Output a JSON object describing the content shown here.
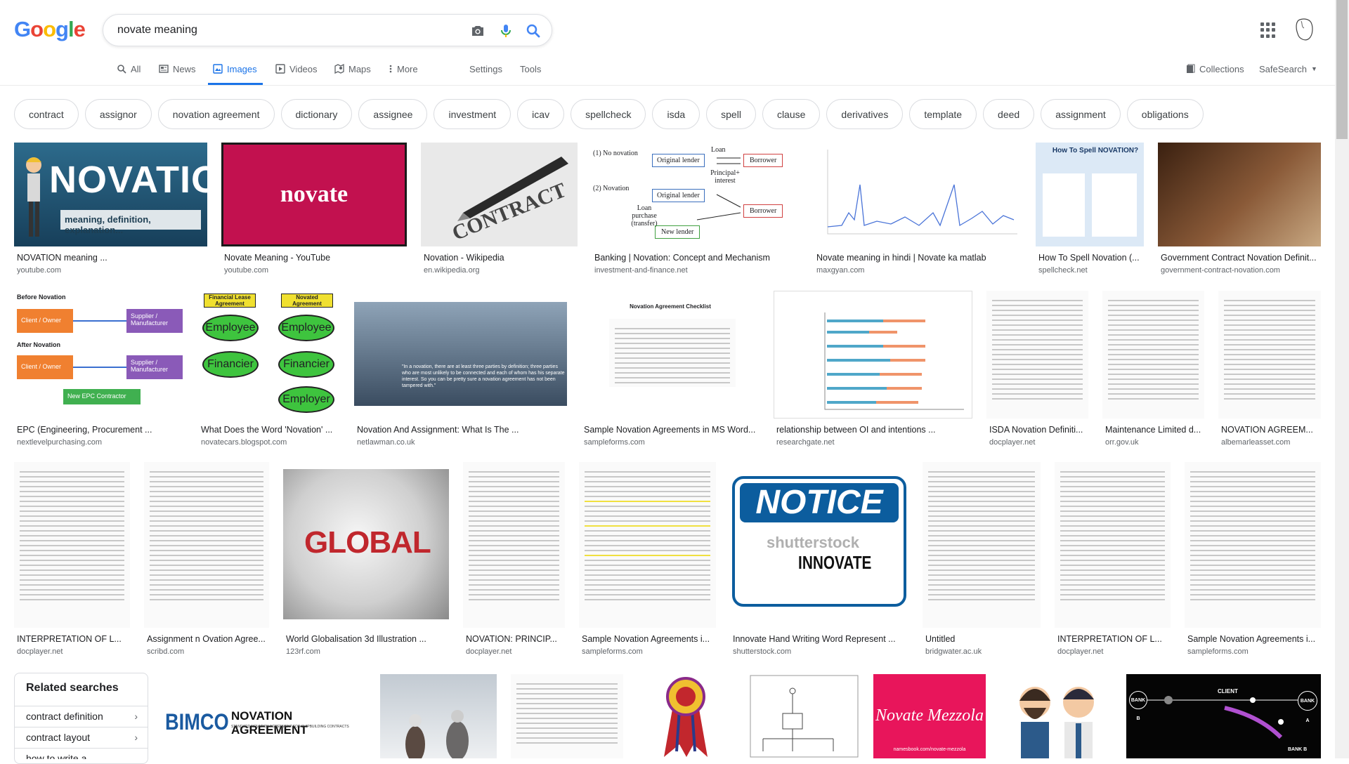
{
  "logo": [
    "G",
    "o",
    "o",
    "g",
    "l",
    "e"
  ],
  "logo_colors": [
    "#4285f4",
    "#ea4335",
    "#fbbc05",
    "#4285f4",
    "#34a853",
    "#ea4335"
  ],
  "search": {
    "query": "novate meaning"
  },
  "tabs": {
    "all": "All",
    "news": "News",
    "images": "Images",
    "videos": "Videos",
    "maps": "Maps",
    "more": "More",
    "settings": "Settings",
    "tools": "Tools",
    "collections": "Collections",
    "safesearch": "SafeSearch"
  },
  "chips": [
    "contract",
    "assignor",
    "novation agreement",
    "dictionary",
    "assignee",
    "investment",
    "icav",
    "spellcheck",
    "isda",
    "spell",
    "clause",
    "derivatives",
    "template",
    "deed",
    "assignment",
    "obligations"
  ],
  "results": [
    {
      "title": "NOVATION meaning ...",
      "source": "youtube.com"
    },
    {
      "title": "Novate Meaning - YouTube",
      "source": "youtube.com"
    },
    {
      "title": "Novation - Wikipedia",
      "source": "en.wikipedia.org"
    },
    {
      "title": "Banking | Novation: Concept and Mechanism",
      "source": "investment-and-finance.net"
    },
    {
      "title": "Novate meaning in hindi | Novate ka matlab",
      "source": "maxgyan.com"
    },
    {
      "title": "How To Spell Novation (...",
      "source": "spellcheck.net"
    },
    {
      "title": "Government Contract Novation Definit...",
      "source": "government-contract-novation.com"
    },
    {
      "title": "EPC (Engineering, Procurement ...",
      "source": "nextlevelpurchasing.com"
    },
    {
      "title": "What Does the Word 'Novation' ...",
      "source": "novatecars.blogspot.com"
    },
    {
      "title": "Novation And Assignment: What Is The ...",
      "source": "netlawman.co.uk"
    },
    {
      "title": "Sample Novation Agreements in MS Word...",
      "source": "sampleforms.com"
    },
    {
      "title": "relationship between OI and intentions ...",
      "source": "researchgate.net"
    },
    {
      "title": "ISDA Novation Definiti...",
      "source": "docplayer.net"
    },
    {
      "title": "Maintenance Limited d...",
      "source": "orr.gov.uk"
    },
    {
      "title": "NOVATION AGREEM...",
      "source": "albemarleasset.com"
    },
    {
      "title": "INTERPRETATION OF L...",
      "source": "docplayer.net"
    },
    {
      "title": "Assignment n Ovation Agree...",
      "source": "scribd.com"
    },
    {
      "title": "World Globalisation 3d Illustration ...",
      "source": "123rf.com"
    },
    {
      "title": "NOVATION: PRINCIP...",
      "source": "docplayer.net"
    },
    {
      "title": "Sample Novation Agreements i...",
      "source": "sampleforms.com"
    },
    {
      "title": "Innovate Hand Writing Word Represent ...",
      "source": "shutterstock.com"
    },
    {
      "title": "Untitled",
      "source": "bridgwater.ac.uk"
    },
    {
      "title": "INTERPRETATION OF L...",
      "source": "docplayer.net"
    },
    {
      "title": "Sample Novation Agreements i...",
      "source": "sampleforms.com"
    }
  ],
  "thumb_text": {
    "novation_big": "NOVATION",
    "novation_sub": "meaning, definition, explanation...",
    "novate": "novate",
    "contract": "CONTRACT",
    "no_novation": "(1) No novation",
    "novation": "(2) Novation",
    "original_lender": "Original lender",
    "borrower": "Borrower",
    "loan": "Loan",
    "principal_interest": "Principal+ interest",
    "new_lender": "New lender",
    "loan_purchase": "Loan purchase (transfer)",
    "how_to_spell": "How To Spell NOVATION?",
    "before_novation": "Before Novation",
    "after_novation": "After Novation",
    "client_owner": "Client / Owner",
    "supplier": "Supplier / Manufacturer",
    "new_epc": "New EPC Contractor",
    "financial_lease": "Financial Lease Agreement",
    "novated_agreement": "Novated Agreement",
    "employee": "Employee",
    "financier": "Financier",
    "employer": "Employer",
    "quote": "\"In a novation, there are at least three parties by definition; three parties who are most unlikely to be connected and each of whom has his separate interest. So you can be pretty sure a novation agreement has not been tampered with.\"",
    "novation_checklist": "Novation Agreement Checklist",
    "global": "GLOBAL",
    "notice": "NOTICE",
    "shutterstock": "shutterstock",
    "innovate": "INNOVATE",
    "bimco": "BIMCO",
    "novation_agreement": "NOVATION AGREEMENT",
    "bimco_sub": "STANDARD NOVATION AGREEMENT FOR SHIPBUILDING CONTRACTS",
    "novate_mezzola": "Novate Mezzola",
    "namesbook": "namesbook.com/novate-mezzola",
    "bank_b": "BANK B",
    "bank_a": "BANK A",
    "client": "CLIENT"
  },
  "related": {
    "title": "Related searches",
    "items": [
      "contract definition",
      "contract layout",
      "how to write a"
    ]
  }
}
